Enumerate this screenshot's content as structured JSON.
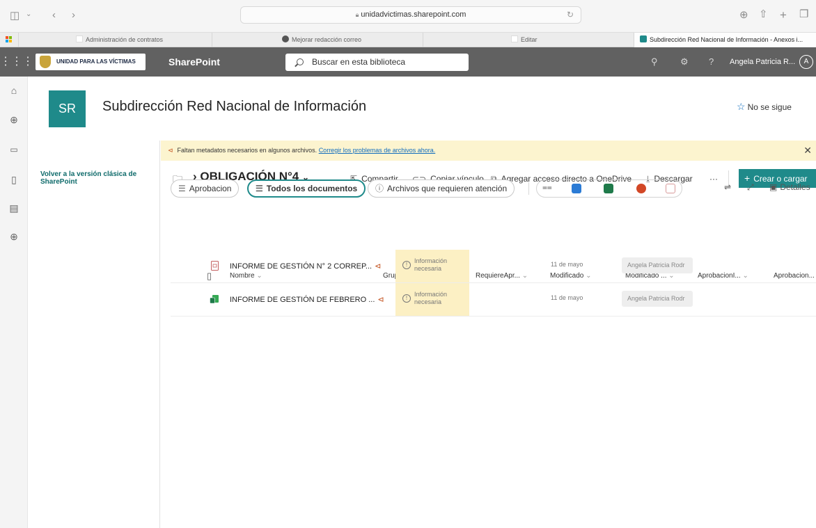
{
  "browser": {
    "url": "unidadvictimas.sharepoint.com",
    "tabs": [
      {
        "label": "Administración de contratos"
      },
      {
        "label": "Mejorar redacción correo"
      },
      {
        "label": "Editar"
      },
      {
        "label": "Subdirección Red Nacional de Información - Anexos i..."
      }
    ]
  },
  "suite": {
    "org_name": "UNIDAD PARA LAS VÍCTIMAS",
    "app_name": "SharePoint",
    "search_placeholder": "Buscar en esta biblioteca",
    "user_name": "Angela Patricia R...",
    "user_initial": "A"
  },
  "site": {
    "logo_text": "SR",
    "title": "Subdirección Red Nacional de Información",
    "follow_label": "No se sigue",
    "accent_color": "#1f8a8a"
  },
  "left_nav": {
    "classic_link": "Volver a la versión clásica de SharePoint"
  },
  "notice": {
    "text": "Faltan metadatos necesarios en algunos archivos.",
    "link": "Corregir los problemas de archivos ahora."
  },
  "command_bar": {
    "folder_title": "OBLIGACIÓN N°4",
    "share": "Compartir",
    "copy_link": "Copiar vínculo",
    "add_shortcut": "Agregar acceso directo a OneDrive",
    "download": "Descargar",
    "more": "···",
    "create": "Crear o cargar"
  },
  "views": {
    "aprobacion": "Aprobacion",
    "todos": "Todos los documentos",
    "atencion": "Archivos que requieren atención",
    "detalles": "Detalles"
  },
  "columns": {
    "nombre": "Nombre",
    "grupo": "Grupo SRNI",
    "requiere": "RequiereApr...",
    "modificado": "Modificado",
    "modificado_por": "Modificado ...",
    "aprobacion1": "AprobacionI...",
    "aprobacion2": "Aprobacion..."
  },
  "rows": [
    {
      "name": "INFORME DE GESTIÓN N° 2 CORREP...",
      "grupo": "Información necesaria",
      "grupo_l1": "Información",
      "grupo_l2": "necesaria",
      "modified": "11 de mayo",
      "modified_by": "Angela Patricia Rodr",
      "file_icon": "pdf-file-icon"
    },
    {
      "name": "INFORME DE GESTIÓN DE FEBRERO ...",
      "grupo": "Información necesaria",
      "grupo_l1": "Información",
      "grupo_l2": "necesaria",
      "modified": "11 de mayo",
      "modified_by": "Angela Patricia Rodr",
      "file_icon": "project-file-icon"
    }
  ]
}
